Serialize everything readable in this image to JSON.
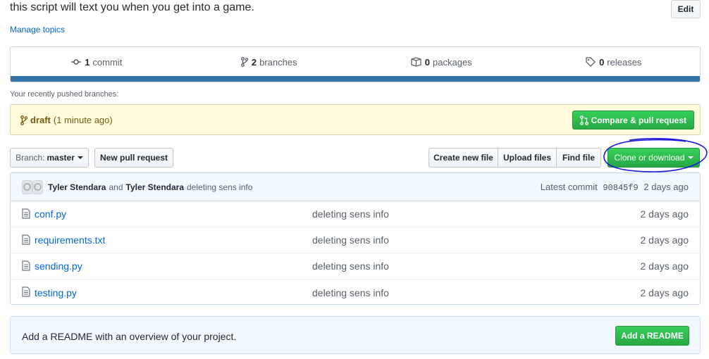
{
  "repo": {
    "description": "this script will text you when you get into a game.",
    "edit_label": "Edit",
    "manage_topics": "Manage topics"
  },
  "stats": {
    "commits": {
      "count": "1",
      "label": "commit",
      "icon": "commit-icon"
    },
    "branches": {
      "count": "2",
      "label": "branches",
      "icon": "branch-icon"
    },
    "packages": {
      "count": "0",
      "label": "packages",
      "icon": "package-icon"
    },
    "releases": {
      "count": "0",
      "label": "releases",
      "icon": "tag-icon"
    },
    "language_color": "#3572A5"
  },
  "recent": {
    "label": "Your recently pushed branches:",
    "branch": "draft",
    "time": "(1 minute ago)",
    "compare_label": "Compare & pull request"
  },
  "toolbar": {
    "branch_prefix": "Branch:",
    "branch_name": "master",
    "new_pr": "New pull request",
    "create_file": "Create new file",
    "upload_files": "Upload files",
    "find_file": "Find file",
    "clone": "Clone or download"
  },
  "commit": {
    "author1": "Tyler Stendara",
    "and": "and",
    "author2": "Tyler Stendara",
    "message": "deleting sens info",
    "latest_label": "Latest commit",
    "sha": "90845f9",
    "age": "2 days ago"
  },
  "files": [
    {
      "name": "conf.py",
      "message": "deleting sens info",
      "age": "2 days ago"
    },
    {
      "name": "requirements.txt",
      "message": "deleting sens info",
      "age": "2 days ago"
    },
    {
      "name": "sending.py",
      "message": "deleting sens info",
      "age": "2 days ago"
    },
    {
      "name": "testing.py",
      "message": "deleting sens info",
      "age": "2 days ago"
    }
  ],
  "readme": {
    "text": "Add a README with an overview of your project.",
    "button": "Add a README"
  },
  "colors": {
    "green": "#28a745",
    "link": "#0366d6",
    "annotation": "#1a1adb"
  }
}
